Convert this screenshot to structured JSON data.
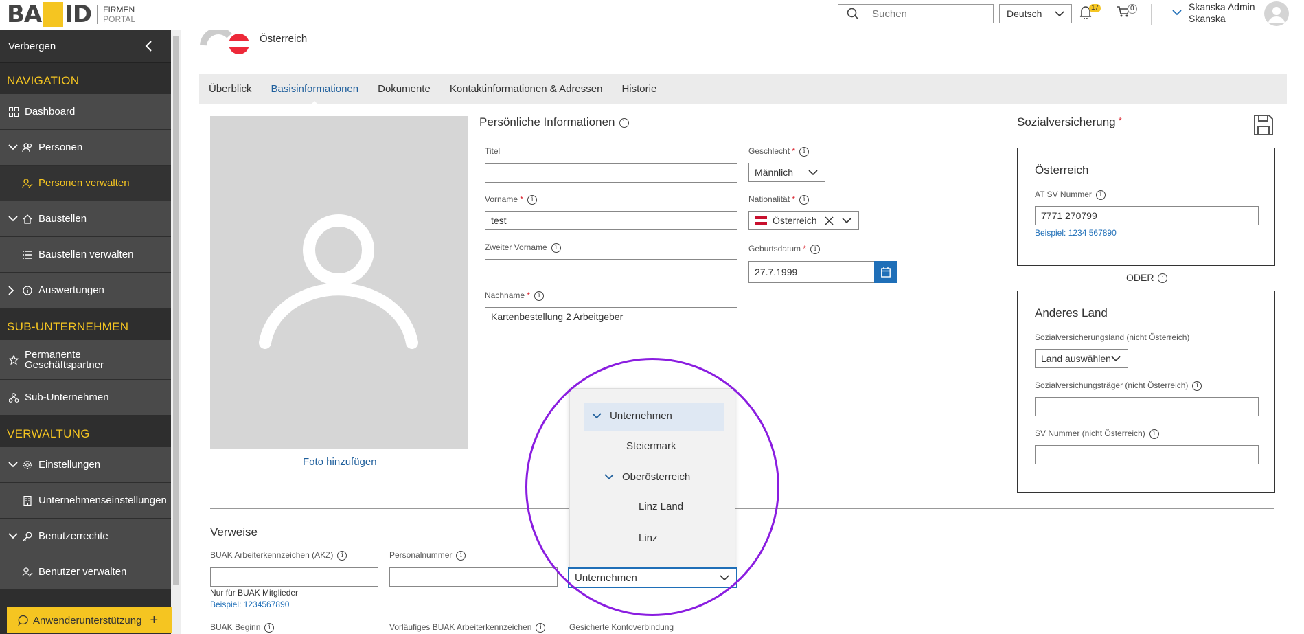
{
  "header": {
    "logo_text_1": "BA",
    "logo_text_2": "ID",
    "logo_sub_1": "FIRMEN",
    "logo_sub_2": "PORTAL",
    "search_placeholder": "Suchen",
    "language": "Deutsch",
    "notifications_count": "17",
    "cart_count": "0",
    "user_name": "Skanska Admin",
    "user_company": "Skanska"
  },
  "sidebar": {
    "hide_label": "Verbergen",
    "sections": {
      "navigation": "NAVIGATION",
      "sub": "SUB-UNTERNEHMEN",
      "admin": "VERWALTUNG"
    },
    "items": {
      "dashboard": "Dashboard",
      "personen": "Personen",
      "personen_verwalten": "Personen verwalten",
      "baustellen": "Baustellen",
      "baustellen_verwalten": "Baustellen verwalten",
      "auswertungen": "Auswertungen",
      "permanente_1": "Permanente",
      "permanente_2": "Geschäftspartner",
      "sub_unternehmen": "Sub-Unternehmen",
      "einstellungen": "Einstellungen",
      "unternehmenseinstellungen": "Unternehmenseinstellungen",
      "benutzerrechte": "Benutzerrechte",
      "benutzer_verwalten": "Benutzer verwalten"
    },
    "support": "Anwenderunterstützung"
  },
  "profile": {
    "country": "Österreich"
  },
  "tabs": [
    "Überblick",
    "Basisinformationen",
    "Dokumente",
    "Kontaktinformationen & Adressen",
    "Historie"
  ],
  "photo": {
    "link": "Foto hinzufügen"
  },
  "personal": {
    "title": "Persönliche Informationen",
    "titel_label": "Titel",
    "titel_value": "",
    "vorname_label": "Vorname",
    "vorname_value": "test",
    "zweiter_label": "Zweiter Vorname",
    "zweiter_value": "",
    "nachname_label": "Nachname",
    "nachname_value": "Kartenbestellung 2 Arbeitgeber",
    "geschlecht_label": "Geschlecht",
    "geschlecht_value": "Männlich",
    "nation_label": "Nationalität",
    "nation_value": "Österreich",
    "geburt_label": "Geburtsdatum",
    "geburt_value": "27.7.1999"
  },
  "social": {
    "title": "Sozialversicherung",
    "at_title": "Österreich",
    "at_sv_label": "AT SV Nummer",
    "at_sv_value": "7771 270799",
    "at_sv_hint": "Beispiel: 1234 567890",
    "oder": "ODER",
    "other_title": "Anderes Land",
    "land_label": "Sozialversicherungsland (nicht Österreich)",
    "land_value": "Land auswählen",
    "traeger_label": "Sozialversichungsträger (nicht Österreich)",
    "sv_label": "SV Nummer (nicht Österreich)"
  },
  "verweise": {
    "title": "Verweise",
    "buak_label": "BUAK Arbeiterkennzeichen (AKZ)",
    "buak_note": "Nur für BUAK Mitglieder",
    "buak_hint": "Beispiel: 1234567890",
    "personal_label": "Personalnummer",
    "unternehmen_value": "Unternehmen",
    "buak_beginn": "BUAK Beginn",
    "vorlaeufig": "Vorläufiges BUAK Arbeiterkennzeichen",
    "konto": "Gesicherte Kontoverbindung"
  },
  "dropdown": {
    "items": [
      "Unternehmen",
      "Steiermark",
      "Oberösterreich",
      "Linz Land",
      "Linz"
    ]
  },
  "colors": {
    "accent": "#f5c521",
    "link": "#1f5f9c",
    "primary": "#1f6fb8",
    "highlight_circle": "#8a1de0"
  }
}
